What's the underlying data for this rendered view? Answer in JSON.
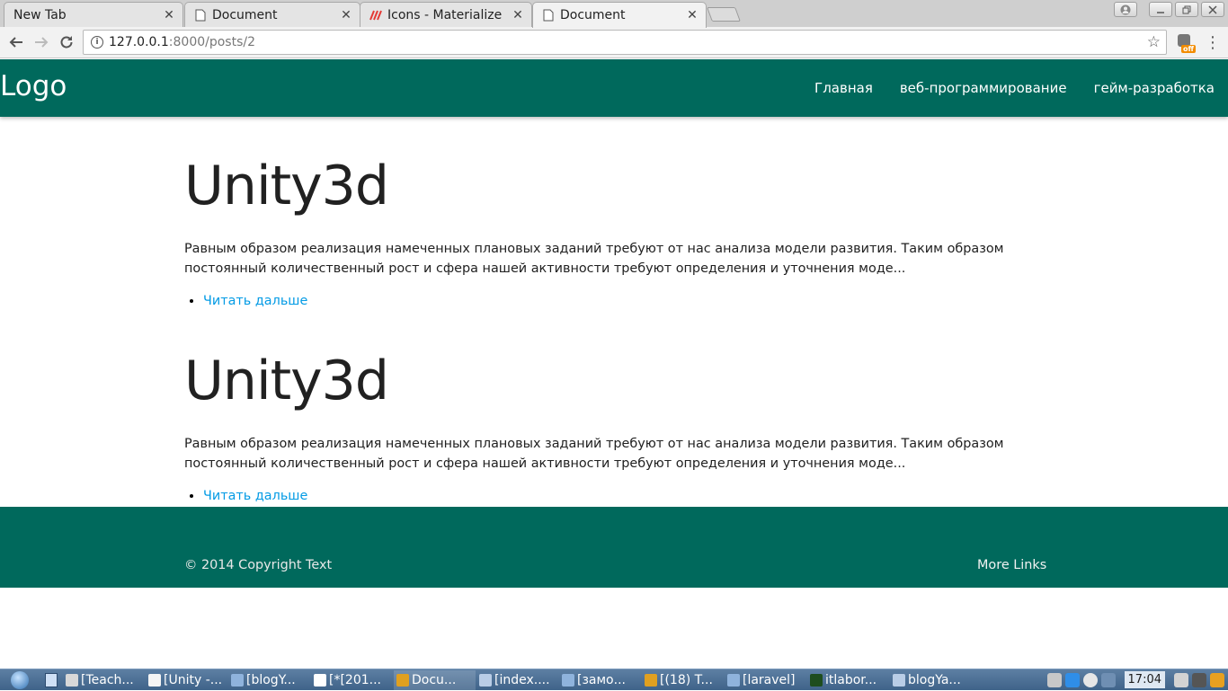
{
  "browser": {
    "tabs": [
      {
        "title": "New Tab",
        "icon": "none",
        "active": false
      },
      {
        "title": "Document",
        "icon": "page-icon",
        "active": false
      },
      {
        "title": "Icons - Materialize",
        "icon": "materialize-icon",
        "active": false
      },
      {
        "title": "Document",
        "icon": "page-icon",
        "active": true
      }
    ],
    "close_glyph": "✕",
    "address": {
      "host": "127.0.0.1",
      "path": ":8000/posts/2"
    },
    "extension_badge": "off"
  },
  "site": {
    "logo": "Logo",
    "nav": [
      "Главная",
      "веб-программирование",
      "гейм-разработка"
    ],
    "posts": [
      {
        "title": "Unity3d",
        "excerpt": "Равным образом реализация намеченных плановых заданий требуют от нас анализа модели развития. Таким образом постоянный количественный рост и сфера нашей активности требуют определения и уточнения моде...",
        "link": "Читать дальше"
      },
      {
        "title": "Unity3d",
        "excerpt": "Равным образом реализация намеченных плановых заданий требуют от нас анализа модели развития. Таким образом постоянный количественный рост и сфера нашей активности требуют определения и уточнения моде...",
        "link": "Читать дальше"
      }
    ],
    "footer": {
      "copyright": "© 2014 Copyright Text",
      "more_links": "More Links"
    },
    "colors": {
      "primary": "#00695c",
      "link": "#039be5"
    }
  },
  "taskbar": {
    "tasks": [
      {
        "label": "[Teach...",
        "icon": "pidgin-icon",
        "color": "#d8d8d8"
      },
      {
        "label": "[Unity -...",
        "icon": "unity-icon",
        "color": "#f5f5f5"
      },
      {
        "label": "[blogY...",
        "icon": "folder-icon",
        "color": "#8fb3dc"
      },
      {
        "label": "[*[201...",
        "icon": "text-editor-icon",
        "color": "#ffffff"
      },
      {
        "label": "Docu...",
        "icon": "chrome-icon",
        "color": "#e0a020"
      },
      {
        "label": "[index....",
        "icon": "window-icon",
        "color": "#b9cde6"
      },
      {
        "label": "[замо...",
        "icon": "folder-icon",
        "color": "#8fb3dc"
      },
      {
        "label": "[(18) T...",
        "icon": "chrome-icon",
        "color": "#e0a020"
      },
      {
        "label": "[laravel]",
        "icon": "folder-icon",
        "color": "#8fb3dc"
      },
      {
        "label": "itlabor...",
        "icon": "terminal-icon",
        "color": "#1e4d1e"
      },
      {
        "label": "blogYa...",
        "icon": "window-icon",
        "color": "#b9cde6"
      }
    ],
    "clock": "17:04"
  }
}
